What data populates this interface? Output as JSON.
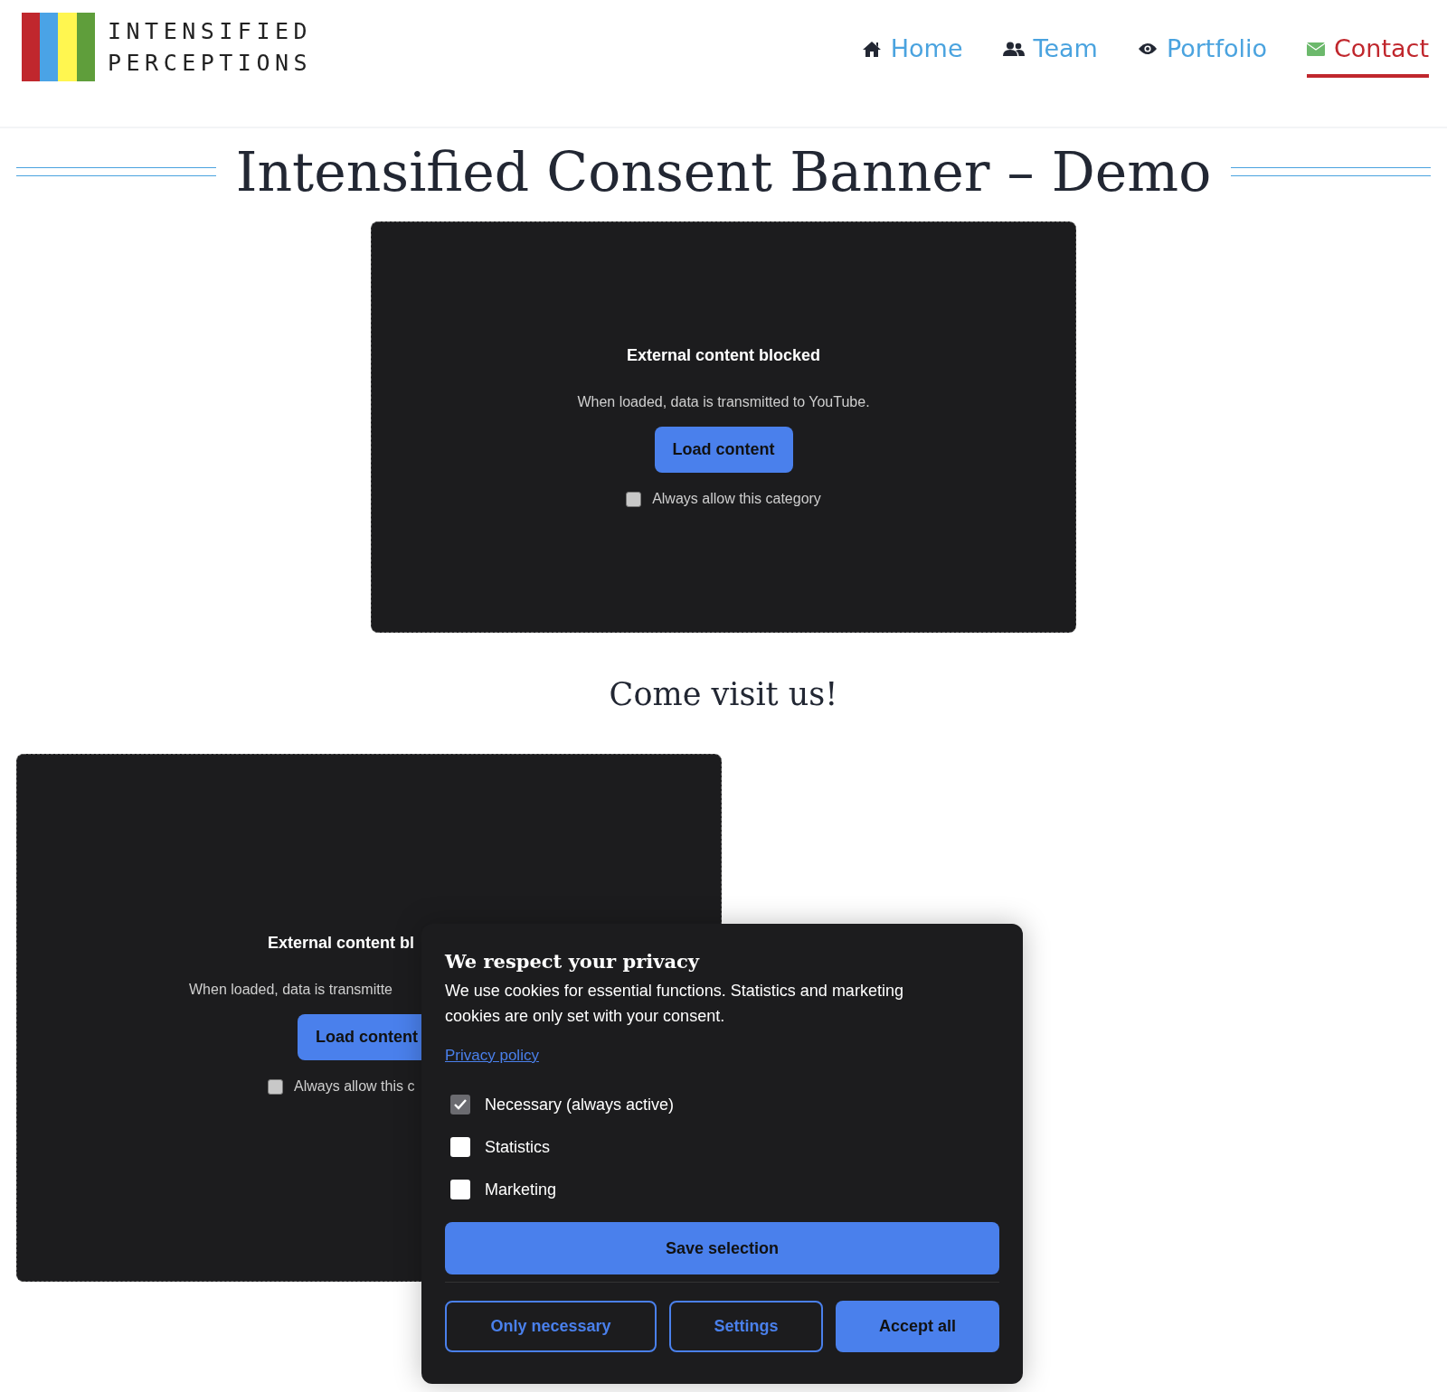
{
  "logo": {
    "line_1": "INTENSIFIED",
    "line_2": "PERCEPTIONS"
  },
  "nav": [
    {
      "label": "Home",
      "kind": "home",
      "selected": false
    },
    {
      "label": "Team",
      "kind": "team",
      "selected": false
    },
    {
      "label": "Portfolio",
      "kind": "eye",
      "selected": false
    },
    {
      "label": "Contact",
      "kind": "mail",
      "selected": true
    }
  ],
  "page_title": "Intensified Consent Banner – Demo",
  "placeholders": [
    {
      "title": "External content blocked",
      "text": "When loaded, data is transmitted to YouTube.",
      "button": "Load content",
      "checkbox": {
        "label": "Always allow this category",
        "checked": false
      }
    }
  ],
  "section_heading": "Come visit us!",
  "covered_placeholder": {
    "title": "External content bl",
    "text": "When loaded, data is transmitte",
    "button": "Load content",
    "checkbox": {
      "label": "Always allow this c",
      "checked": false
    }
  },
  "consent_banner": {
    "title": "We respect your privacy",
    "text": "We use cookies for essential functions. Statistics and marketing cookies are only set with your consent.",
    "link": "Privacy policy",
    "categories": [
      {
        "label": "Necessary (always active)",
        "checked": true,
        "disabled": true
      },
      {
        "label": "Statistics",
        "checked": false,
        "disabled": false
      },
      {
        "label": "Marketing",
        "checked": false,
        "disabled": false
      }
    ],
    "save_button": "Save selection",
    "buttons": [
      {
        "label": "Only necessary",
        "kind": "outline"
      },
      {
        "label": "Settings",
        "kind": "outline"
      },
      {
        "label": "Accept all",
        "kind": "filled"
      }
    ]
  }
}
